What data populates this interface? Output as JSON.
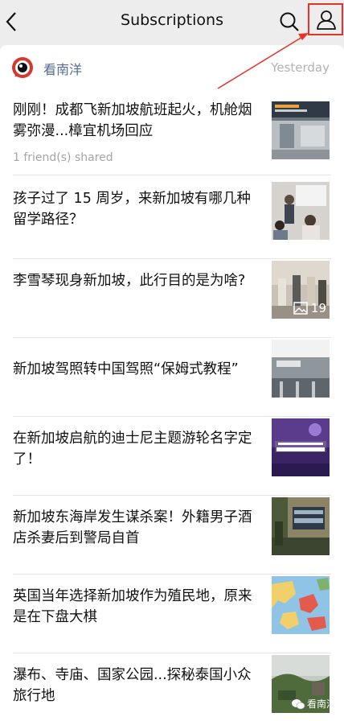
{
  "header": {
    "title": "Subscriptions",
    "back_icon": "chevron-left-icon",
    "search_icon": "search-icon",
    "profile_icon": "person-icon"
  },
  "account": {
    "name": "看南洋",
    "time": "Yesterday"
  },
  "articles": [
    {
      "title": "刚刚！成都飞新加坡航班起火，机舱烟雾弥漫...樟宜机场回应",
      "sub": "1 friend(s) shared"
    },
    {
      "title": "孩子过了 15 周岁，来新加坡有哪几种留学路径？"
    },
    {
      "title": "李雪琴现身新加坡，此行目的是为啥?",
      "image_count": "19"
    },
    {
      "title": "新加坡驾照转中国驾照“保姆式教程”"
    },
    {
      "title": "在新加坡启航的迪士尼主题游轮名字定了！"
    },
    {
      "title": "新加坡东海岸发生谋杀案！外籍男子酒店杀妻后到警局自首"
    },
    {
      "title": "英国当年选择新加坡作为殖民地，原来是在下盘大棋"
    },
    {
      "title": "瀑布、寺庙、国家公园...探秘泰国小众旅行地"
    }
  ],
  "watermark": "看南洋",
  "colors": {
    "accent": "#576b95",
    "annotation": "#e5332a"
  }
}
